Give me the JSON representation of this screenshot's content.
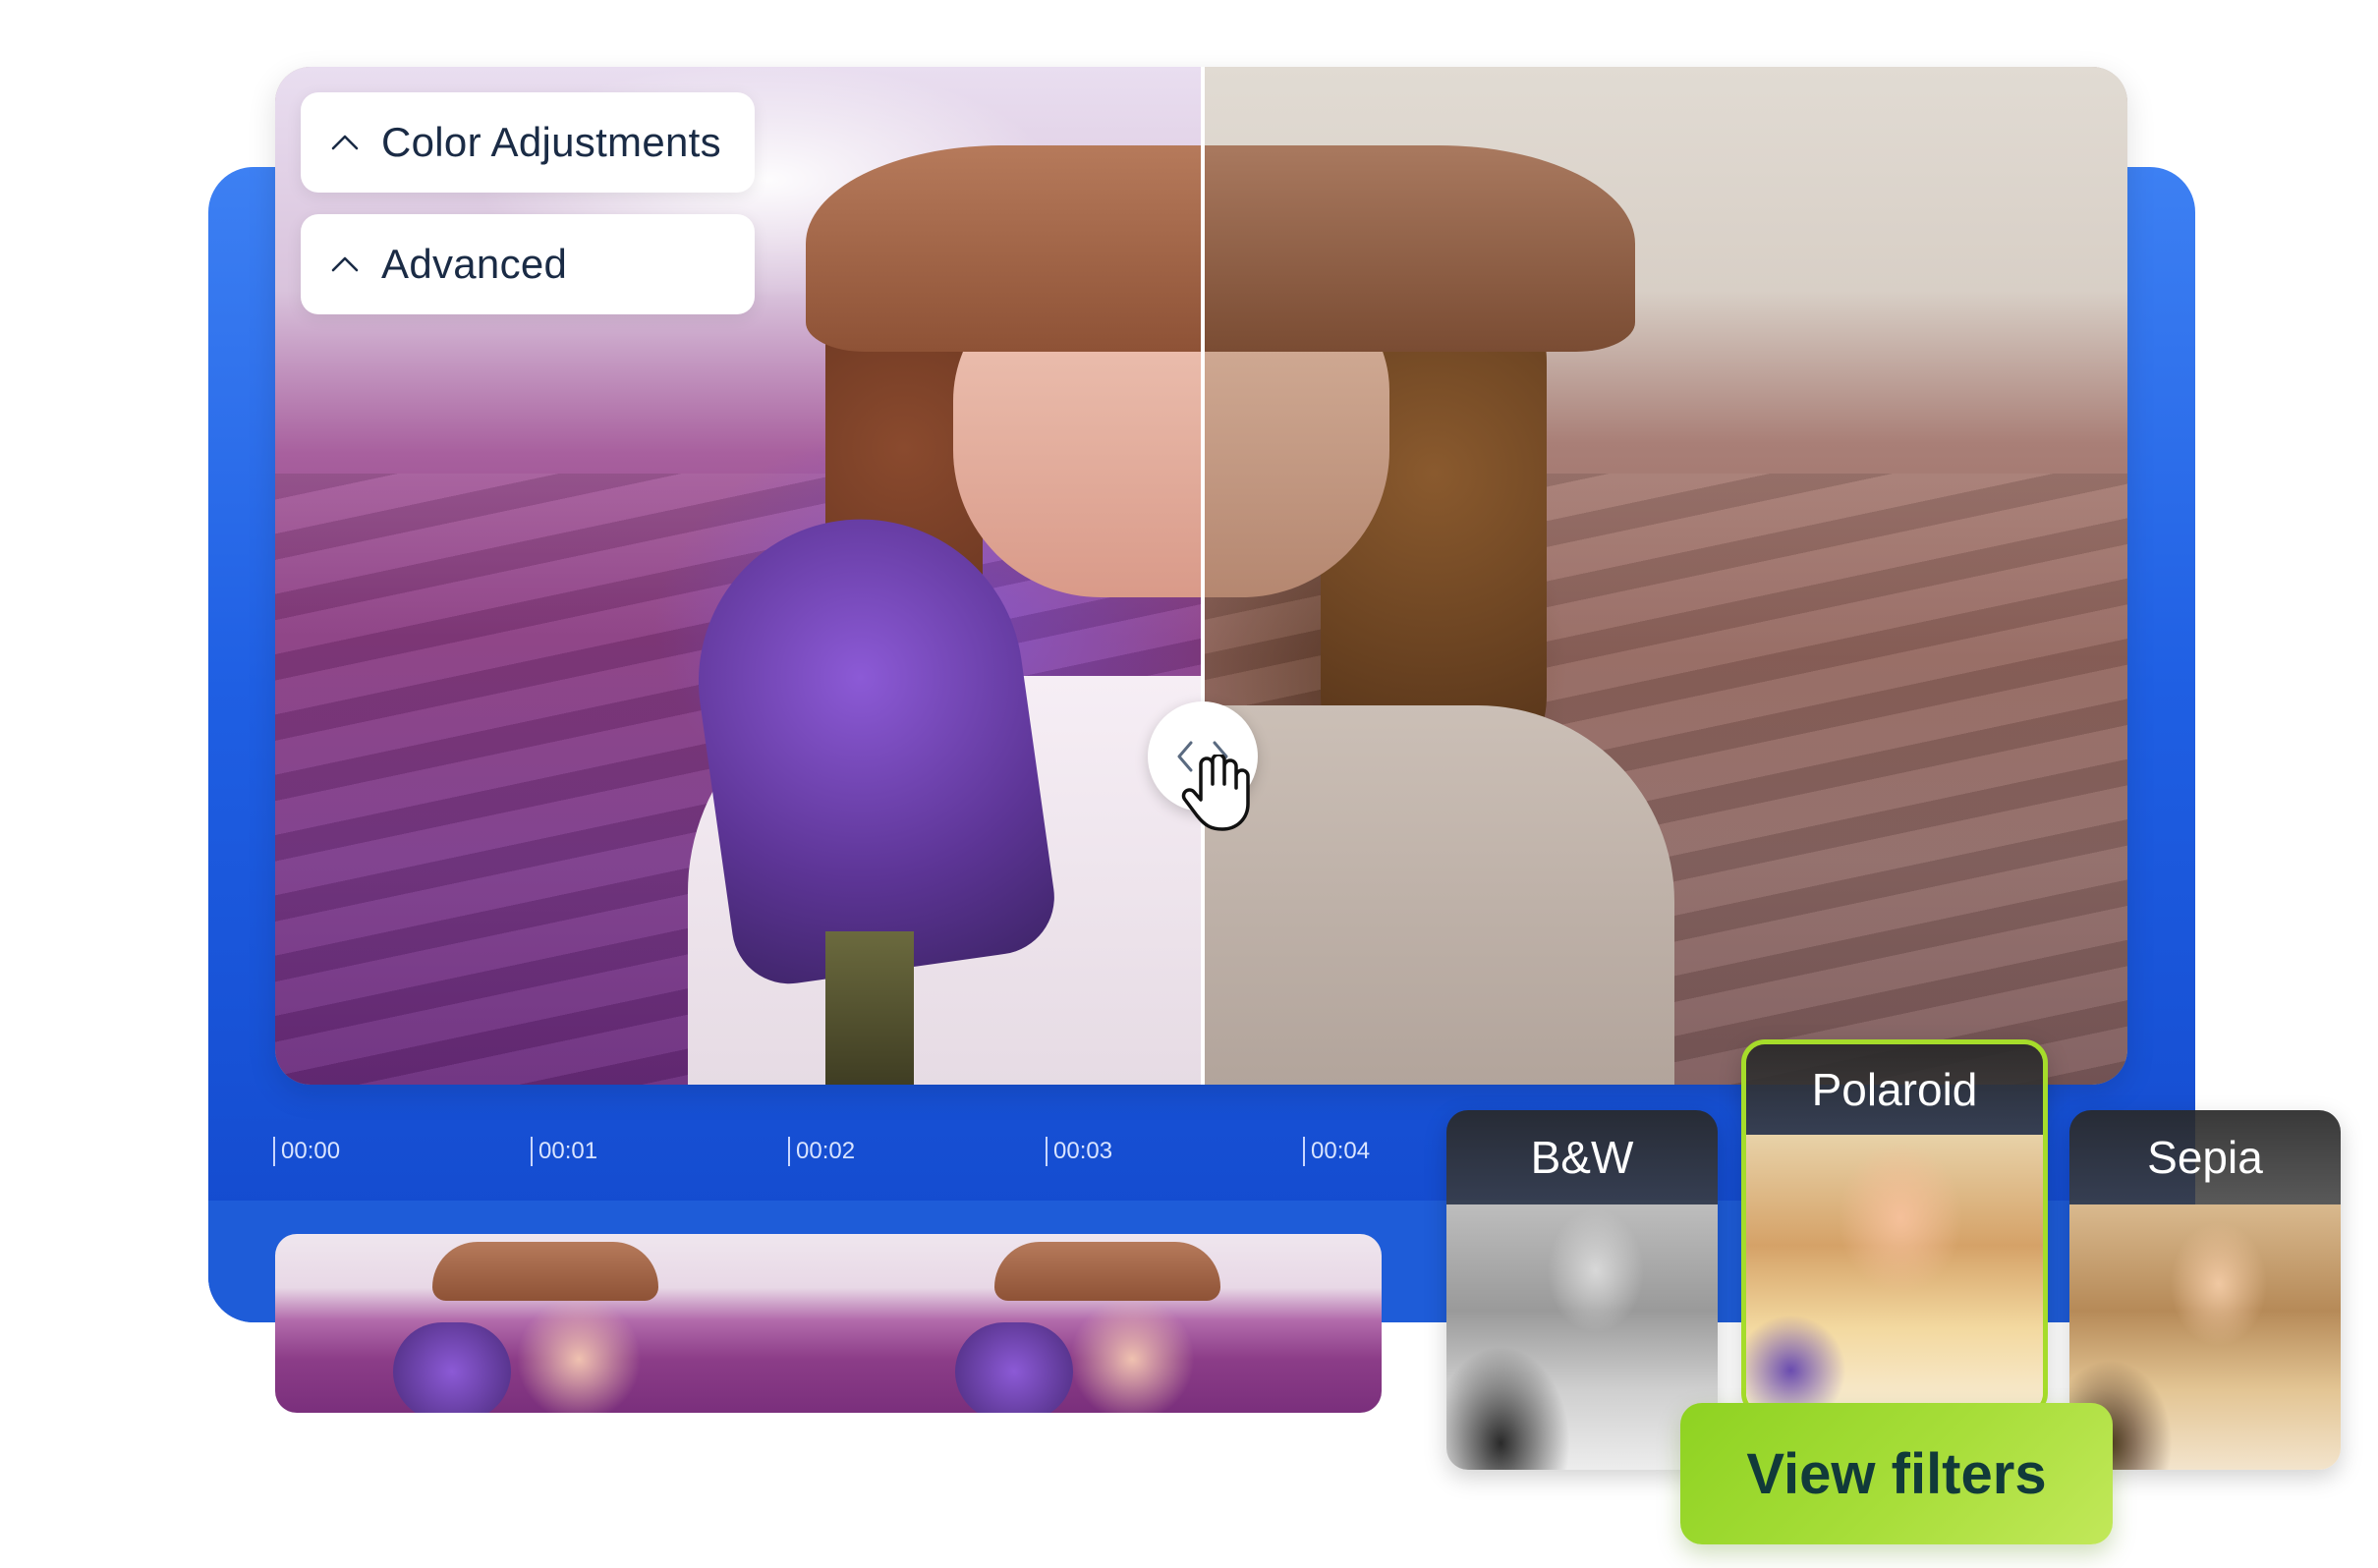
{
  "panels": {
    "color_adjustments": "Color Adjustments",
    "advanced": "Advanced"
  },
  "timeline": {
    "ticks": [
      "00:00",
      "00:01",
      "00:02",
      "00:03",
      "00:04"
    ]
  },
  "filters": {
    "bw_label": "B&W",
    "polaroid_label": "Polaroid",
    "sepia_label": "Sepia",
    "selected": "Polaroid"
  },
  "cta": {
    "view_filters_label": "View filters"
  },
  "icons": {
    "panel_collapse": "chevron-up-icon",
    "compare_handle": "left-right-arrows-icon",
    "cursor": "hand-cursor-icon"
  },
  "colors": {
    "brand_blue": "#1f5fe3",
    "accent_green": "#a6dc2a",
    "panel_text": "#1a2b45"
  }
}
